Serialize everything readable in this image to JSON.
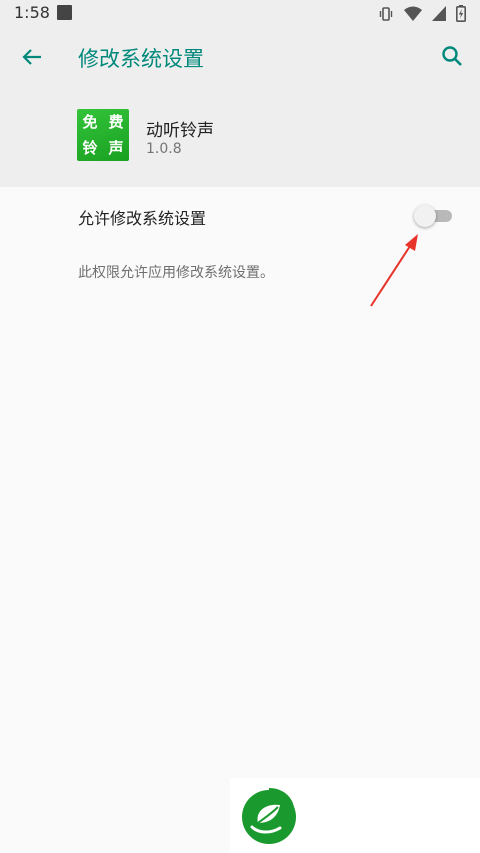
{
  "status_bar": {
    "time": "1:58",
    "icons": [
      "vibrate-icon",
      "wifi-icon",
      "signal-icon",
      "battery-icon"
    ]
  },
  "app_bar": {
    "back_icon": "back-arrow-icon",
    "title": "修改系统设置",
    "search_icon": "search-icon",
    "accent_color": "#00897b"
  },
  "app_info": {
    "icon_chars": [
      "免",
      "费",
      "铃",
      "声"
    ],
    "name": "动听铃声",
    "version": "1.0.8",
    "icon_color": "#2bb533"
  },
  "setting": {
    "label": "允许修改系统设置",
    "enabled": false,
    "summary": "此权限允许应用修改系统设置。"
  },
  "annotation": {
    "arrow_color": "#e8332a"
  },
  "watermark": {
    "logo_icon": "leaf-logo-icon",
    "logo_color": "#1a9a2e"
  }
}
